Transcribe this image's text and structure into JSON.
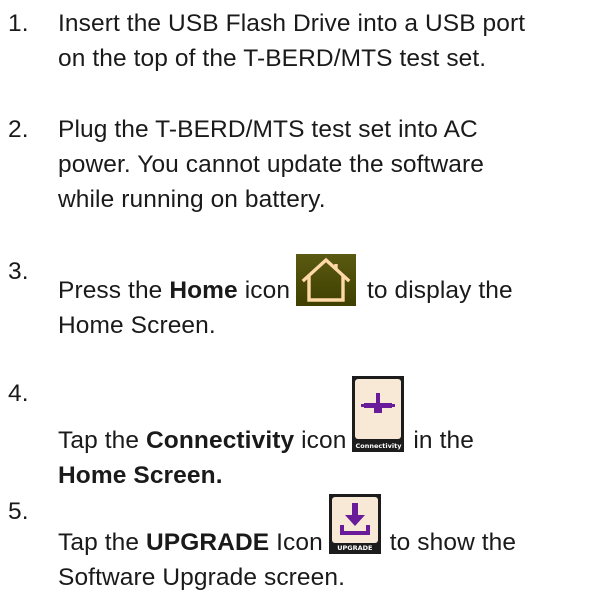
{
  "steps": [
    {
      "number": "1.",
      "line1": "Insert the USB Flash Drive into a USB port",
      "line2": "on the top of the T-BERD/MTS test set."
    },
    {
      "number": "2.",
      "line1": "Plug the T-BERD/MTS test set into AC",
      "line2": "power.  You cannot update the software",
      "line3": "while running on battery."
    },
    {
      "number": "3.",
      "pre": "Press the ",
      "bold": "Home",
      "mid": " icon",
      "post": " to display the",
      "line2": "Home Screen.",
      "icon": "home-icon"
    },
    {
      "number": "4.",
      "pre": "Tap the ",
      "bold": "Connectivity",
      "mid": " icon",
      "post": " in the",
      "line2_bold": "Home Screen.",
      "icon": "connectivity-icon",
      "icon_caption": "Connectivity"
    },
    {
      "number": "5.",
      "pre": "Tap the ",
      "bold": "UPGRADE",
      "mid": " Icon",
      "post": " to show the",
      "line2": "Software Upgrade screen.",
      "icon": "upgrade-icon",
      "icon_caption": "UPGRADE"
    }
  ],
  "colors": {
    "text": "#1a1a1a",
    "home_tile": "#4b4b00",
    "icon_face": "#f7e9d5",
    "icon_glyph": "#6a1b9a"
  }
}
